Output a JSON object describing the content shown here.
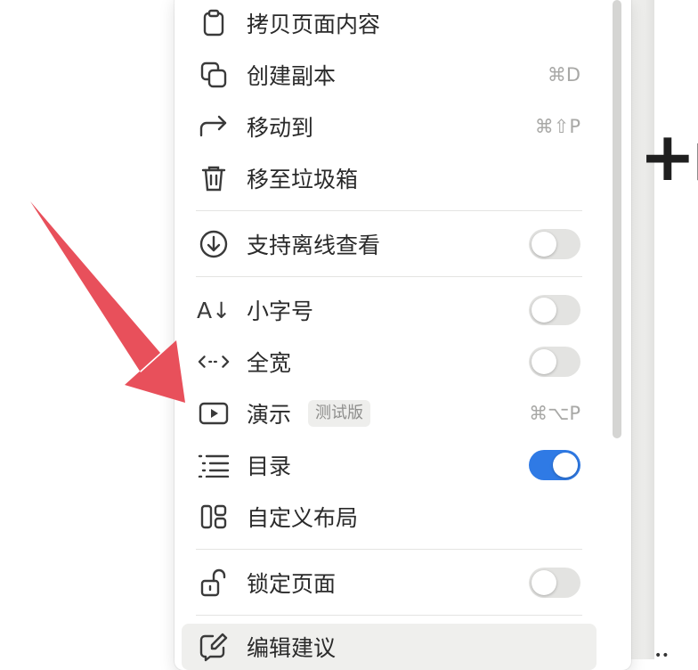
{
  "menu": {
    "items": [
      {
        "label": "拷贝页面内容",
        "icon": "clipboard-icon"
      },
      {
        "label": "创建副本",
        "icon": "duplicate-icon",
        "shortcut": "⌘D"
      },
      {
        "label": "移动到",
        "icon": "move-arrow-icon",
        "shortcut": "⌘⇧P"
      },
      {
        "label": "移至垃圾箱",
        "icon": "trash-icon"
      },
      {
        "label": "支持离线查看",
        "icon": "download-circle-icon",
        "toggle": false
      },
      {
        "label": "小字号",
        "icon": "font-size-icon",
        "icon_text": "A↓",
        "toggle": false
      },
      {
        "label": "全宽",
        "icon": "full-width-icon",
        "icon_text": "←→",
        "toggle": false
      },
      {
        "label": "演示",
        "icon": "present-icon",
        "badge": "测试版",
        "shortcut": "⌘⌥P"
      },
      {
        "label": "目录",
        "icon": "table-of-contents-icon",
        "toggle": true
      },
      {
        "label": "自定义布局",
        "icon": "layout-icon"
      },
      {
        "label": "锁定页面",
        "icon": "unlock-icon",
        "toggle": false
      },
      {
        "label": "编辑建议",
        "icon": "edit-suggest-icon"
      }
    ]
  },
  "colors": {
    "toggle_on": "#2f7ae5",
    "toggle_off": "#e3e3e1",
    "arrow": "#e8505b"
  }
}
